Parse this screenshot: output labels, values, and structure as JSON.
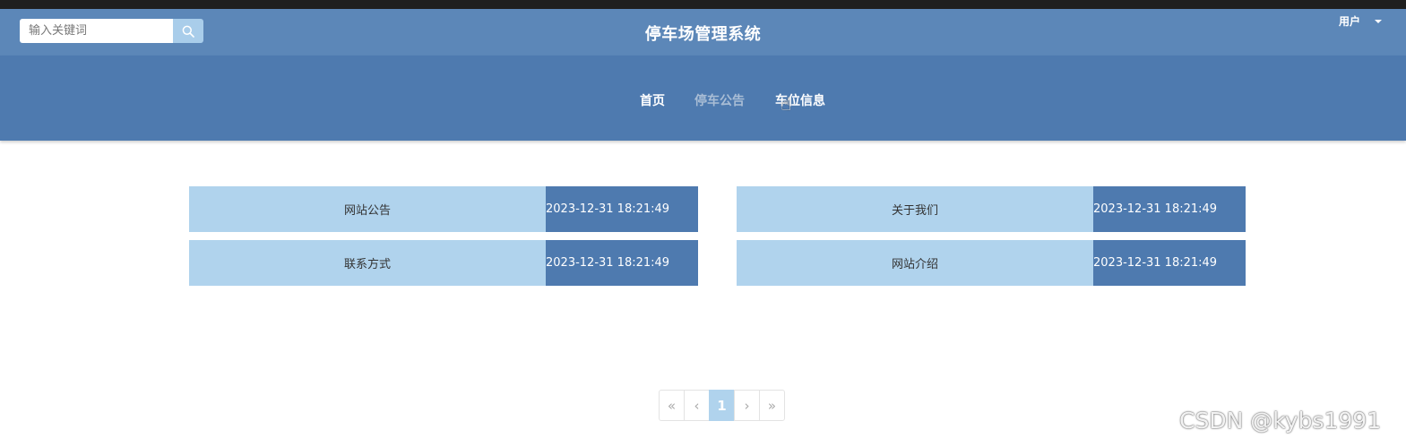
{
  "header": {
    "search": {
      "placeholder": "输入关键词",
      "value": ""
    },
    "title": "停车场管理系统",
    "user_menu": {
      "label": "用户"
    }
  },
  "nav": {
    "items": [
      {
        "label": "首页"
      },
      {
        "label": "停车公告"
      },
      {
        "label": "车位信息"
      }
    ]
  },
  "notices": [
    {
      "title": "网站公告",
      "date": "2023-12-31 18:21:49"
    },
    {
      "title": "关于我们",
      "date": "2023-12-31 18:21:49"
    },
    {
      "title": "联系方式",
      "date": "2023-12-31 18:21:49"
    },
    {
      "title": "网站介绍",
      "date": "2023-12-31 18:21:49"
    }
  ],
  "pagination": {
    "first": "«",
    "prev": "‹",
    "current": "1",
    "next": "›",
    "last": "»"
  },
  "watermark": "CSDN @kybs1991",
  "colors": {
    "header": "#5c87b8",
    "nav": "#4e7aaf",
    "card_light": "#b0d3ed",
    "card_dark": "#4e7aaf"
  }
}
